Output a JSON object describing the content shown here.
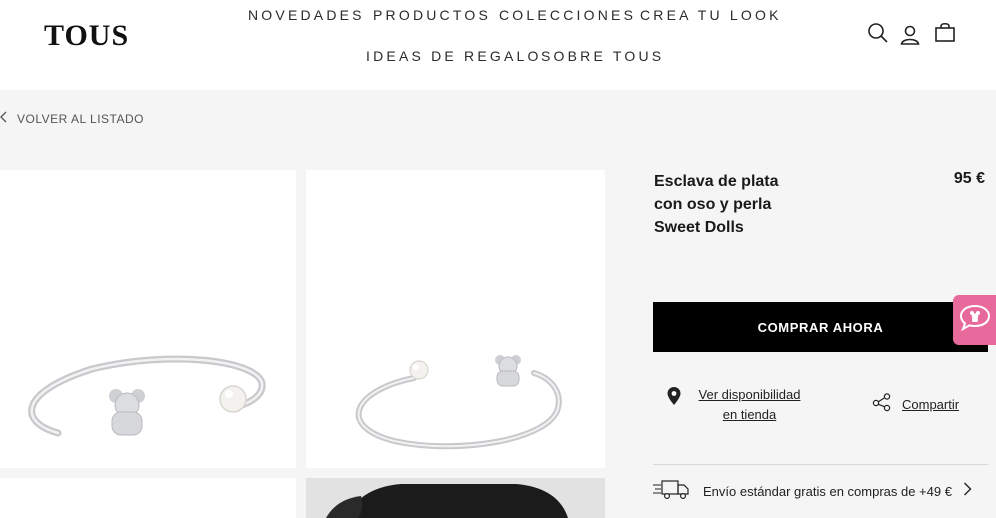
{
  "header": {
    "logo": "TOUS",
    "nav": [
      "NOVEDADES",
      "PRODUCTOS",
      "COLECCIONES",
      "CREA TU LOOK",
      "IDEAS DE REGALO",
      "SOBRE TOUS"
    ],
    "icons": [
      "search-icon",
      "user-icon",
      "bag-icon"
    ]
  },
  "back_link": "VOLVER AL LISTADO",
  "product": {
    "title_lines": [
      "Esclava de plata",
      "con oso y perla",
      "Sweet Dolls"
    ],
    "price": "95 €",
    "buy_label": "COMPRAR AHORA",
    "store_lines": [
      "Ver disponibilidad",
      "en tienda"
    ],
    "share_label": "Compartir",
    "shipping_text": "Envío estándar gratis en compras de +49 €"
  },
  "colors": {
    "accent_pink": "#e86a9c",
    "button_black": "#000000",
    "page_bg": "#f5f5f5"
  }
}
